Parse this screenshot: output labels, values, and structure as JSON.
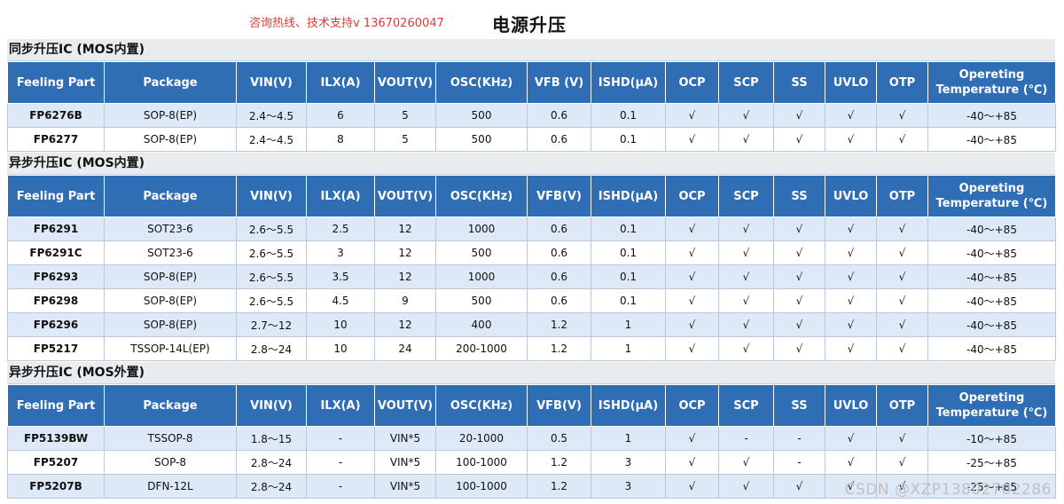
{
  "header": {
    "contact_text": "咨询热线、技术支持v 13670260047",
    "main_title": "电源升压",
    "contact_color": "#e03b3b"
  },
  "colors": {
    "header_bg": "#2f6db5",
    "alt_row_bg": "#dde9f6",
    "section_bg": "#e9ecef"
  },
  "columns_default": [
    "Feeling Part",
    "Package",
    "VIN(V)",
    "ILX(A)",
    "VOUT(V)",
    "OSC(KHz)",
    "VFB (V)",
    "ISHD(μA)",
    "OCP",
    "SCP",
    "SS",
    "UVLO",
    "OTP",
    "Opereting Temperature (℃)"
  ],
  "sections": [
    {
      "title": "同步升压IC (MOS内置)",
      "columns": [
        "Feeling Part",
        "Package",
        "VIN(V)",
        "ILX(A)",
        "VOUT(V)",
        "OSC(KHz)",
        "VFB (V)",
        "ISHD(μA)",
        "OCP",
        "SCP",
        "SS",
        "UVLO",
        "OTP",
        "Opereting Temperature (℃)"
      ],
      "rows": [
        [
          "FP6276B",
          "SOP-8(EP)",
          "2.4～4.5",
          "6",
          "5",
          "500",
          "0.6",
          "0.1",
          "√",
          "√",
          "√",
          "√",
          "√",
          "-40～+85"
        ],
        [
          "FP6277",
          "SOP-8(EP)",
          "2.4～4.5",
          "8",
          "5",
          "500",
          "0.6",
          "0.1",
          "√",
          "√",
          "√",
          "√",
          "√",
          "-40～+85"
        ]
      ]
    },
    {
      "title": "异步升压IC (MOS内置)",
      "columns": [
        "Feeling Part",
        "Package",
        "VIN(V)",
        "ILX(A)",
        "VOUT(V)",
        "OSC(KHz)",
        "VFB(V)",
        "ISHD(μA)",
        "OCP",
        "SCP",
        "SS",
        "UVLO",
        "OTP",
        "Opereting Temperature (℃)"
      ],
      "rows": [
        [
          "FP6291",
          "SOT23-6",
          "2.6～5.5",
          "2.5",
          "12",
          "1000",
          "0.6",
          "0.1",
          "√",
          "√",
          "√",
          "√",
          "√",
          "-40～+85"
        ],
        [
          "FP6291C",
          "SOT23-6",
          "2.6～5.5",
          "3",
          "12",
          "500",
          "0.6",
          "0.1",
          "√",
          "√",
          "√",
          "√",
          "√",
          "-40～+85"
        ],
        [
          "FP6293",
          "SOP-8(EP)",
          "2.6～5.5",
          "3.5",
          "12",
          "1000",
          "0.6",
          "0.1",
          "√",
          "√",
          "√",
          "√",
          "√",
          "-40～+85"
        ],
        [
          "FP6298",
          "SOP-8(EP)",
          "2.6～5.5",
          "4.5",
          "9",
          "500",
          "0.6",
          "0.1",
          "√",
          "√",
          "√",
          "√",
          "√",
          "-40～+85"
        ],
        [
          "FP6296",
          "SOP-8(EP)",
          "2.7～12",
          "10",
          "12",
          "400",
          "1.2",
          "1",
          "√",
          "√",
          "√",
          "√",
          "√",
          "-40～+85"
        ],
        [
          "FP5217",
          "TSSOP-14L(EP)",
          "2.8～24",
          "10",
          "24",
          "200-1000",
          "1.2",
          "1",
          "√",
          "√",
          "√",
          "√",
          "√",
          "-40～+85"
        ]
      ]
    },
    {
      "title": "异步升压IC (MOS外置)",
      "columns": [
        "Feeling Part",
        "Package",
        "VIN(V)",
        "ILX(A)",
        "VOUT(V)",
        "OSC(KHz)",
        "VFB(V)",
        "ISHD(μA)",
        "OCP",
        "SCP",
        "SS",
        "UVLO",
        "OTP",
        "Opereting Temperature (℃)"
      ],
      "rows": [
        [
          "FP5139BW",
          "TSSOP-8",
          "1.8～15",
          "-",
          "VIN*5",
          "20-1000",
          "0.5",
          "1",
          "√",
          "-",
          "-",
          "√",
          "√",
          "-10～+85"
        ],
        [
          "FP5207",
          "SOP-8",
          "2.8～24",
          "-",
          "VIN*5",
          "100-1000",
          "1.2",
          "3",
          "√",
          "√",
          "-",
          "√",
          "√",
          "-25～+85"
        ],
        [
          "FP5207B",
          "DFN-12L",
          "2.8～24",
          "-",
          "VIN*5",
          "100-1000",
          "1.2",
          "3",
          "√",
          "√",
          "√",
          "√",
          "√",
          "-25～+85"
        ]
      ]
    }
  ],
  "watermark": "CSDN @XZP13802702286"
}
